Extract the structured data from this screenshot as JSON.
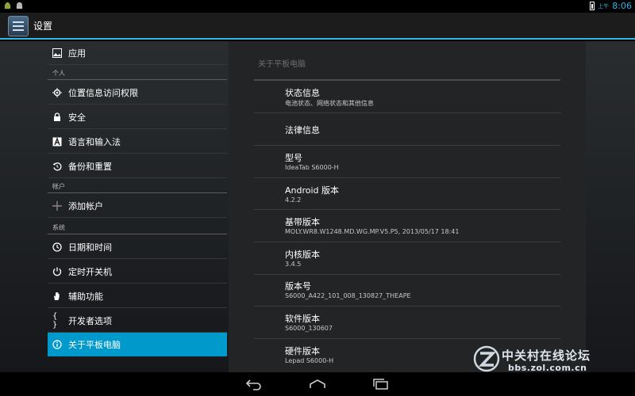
{
  "status_bar": {
    "ampm": "上午",
    "time": "8:06",
    "left_icons": [
      "android-debug-icon",
      "android-icon"
    ]
  },
  "header": {
    "title": "设置",
    "icon": "settings-app-icon"
  },
  "sidebar": {
    "items": [
      {
        "label": "应用",
        "icon": "image-icon"
      },
      {
        "label": "位置信息访问权限",
        "icon": "location-icon"
      },
      {
        "label": "安全",
        "icon": "lock-icon"
      },
      {
        "label": "语言和输入法",
        "icon": "keyboard-a-icon"
      },
      {
        "label": "备份和重置",
        "icon": "restore-icon"
      },
      {
        "label": "添加帐户",
        "icon": "plus-icon"
      },
      {
        "label": "日期和时间",
        "icon": "clock-icon"
      },
      {
        "label": "定时开关机",
        "icon": "power-clock-icon"
      },
      {
        "label": "辅助功能",
        "icon": "hand-icon"
      },
      {
        "label": "开发者选项",
        "icon": "braces-icon"
      },
      {
        "label": "关于平板电脑",
        "icon": "info-icon"
      }
    ],
    "sections": [
      "个人",
      "帐户",
      "系统"
    ]
  },
  "panel": {
    "title": "关于平板电脑",
    "items": [
      {
        "title": "状态信息",
        "sub": "电池状态、网络状态和其他信息"
      },
      {
        "title": "法律信息",
        "sub": ""
      },
      {
        "title": "型号",
        "sub": "IdeaTab S6000-H"
      },
      {
        "title": "Android 版本",
        "sub": "4.2.2"
      },
      {
        "title": "基带版本",
        "sub": "MOLY.WR8.W1248.MD.WG.MP.V5.P5, 2013/05/17 18:41"
      },
      {
        "title": "内核版本",
        "sub": "3.4.5"
      },
      {
        "title": "版本号",
        "sub": "S6000_A422_101_008_130827_THEAPE"
      },
      {
        "title": "软件版本",
        "sub": "S6000_130607"
      },
      {
        "title": "硬件版本",
        "sub": "Lepad S6000-H"
      }
    ]
  },
  "watermark": {
    "name": "中关村在线论坛",
    "url": "bbs.zol.com.cn"
  },
  "nav": {
    "buttons": [
      "back-icon",
      "home-icon",
      "recents-icon"
    ]
  },
  "colors": {
    "accent": "#33b5e5",
    "selected": "#0099cc"
  }
}
